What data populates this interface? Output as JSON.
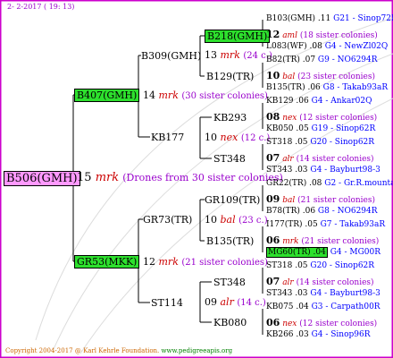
{
  "header": {
    "date": "2- 2-2017 ( 19: 13)"
  },
  "footer": {
    "copyright": "Copyright 2004-2017 @ Karl Kehrle Foundation.",
    "site": "www.pedigreeapis.org"
  },
  "root": {
    "id": "B506(GMH)",
    "num": "15",
    "mrk": "mrk",
    "note": "(Drones from 30 sister colonies)"
  },
  "g1": [
    {
      "id": "B407(GMH)",
      "num": "14",
      "mrk": "mrk",
      "note": "(30 sister colonies)"
    },
    {
      "id": "GR53(MKK)",
      "num": "12",
      "mrk": "mrk",
      "note": "(21 sister colonies)"
    }
  ],
  "g2": [
    {
      "id": "B309(GMH)"
    },
    {
      "id": "KB177"
    },
    {
      "id": "GR73(TR)"
    },
    {
      "id": "ST114"
    }
  ],
  "g2c": [
    {
      "num": "13",
      "mrk": "mrk",
      "note": "(24 c.)"
    },
    {
      "num": "10",
      "mrk": "nex",
      "note": "(12 c.)"
    },
    {
      "num": "10",
      "mrk": "bal",
      "note": "(23 c.)"
    },
    {
      "num": "09",
      "mrk": "alr",
      "note": "(14 c.)"
    }
  ],
  "g3": [
    "B218(GMH)",
    "B129(TR)",
    "KB293",
    "ST348",
    "GR109(TR)",
    "B135(TR)",
    "ST348",
    "KB080"
  ],
  "g4": [
    {
      "top": "B103(GMH) .11",
      "topb": "G21 - Sinop72R",
      "num": "12",
      "mrk": "aml",
      "note": "(18 sister colonies)",
      "bot": "L083(WF) .08",
      "botb": "G4 - NewZl02Q"
    },
    {
      "top": "B82(TR) .07",
      "topb": "G9 - NO6294R",
      "num": "10",
      "mrk": "bal",
      "note": "(23 sister colonies)",
      "bot": "B135(TR) .06",
      "botb": "G8 - Takab93aR"
    },
    {
      "top": "KB129 .06",
      "topb": "G4 - Ankar02Q",
      "num": "08",
      "mrk": "nex",
      "note": "(12 sister colonies)",
      "bot": "KB050 .05",
      "botb": "G19 - Sinop62R"
    },
    {
      "top": "ST318 .05",
      "topb": "G20 - Sinop62R",
      "num": "07",
      "mrk": "alr",
      "note": "(14 sister colonies)",
      "bot": "ST343 .03",
      "botb": "G4 - Bayburt98-3"
    },
    {
      "top": "GR22(TR) .08",
      "topb": "G2 - Gr.R.mounta",
      "num": "09",
      "mrk": "bal",
      "note": "(21 sister colonies)",
      "bot": "B78(TR) .06",
      "botb": "G8 - NO6294R"
    },
    {
      "top": "I177(TR) .05",
      "topb": "G7 - Takab93aR",
      "num": "06",
      "mrk": "mrk",
      "note": "(21 sister colonies)",
      "bot": "MG60(TR) .04",
      "botb": "G4 - MG00R"
    },
    {
      "top": "ST318 .05",
      "topb": "G20 - Sinop62R",
      "num": "07",
      "mrk": "alr",
      "note": "(14 sister colonies)",
      "bot": "ST343 .03",
      "botb": "G4 - Bayburt98-3"
    },
    {
      "top": "KB075 .04",
      "topb": "G3 - Carpath00R",
      "num": "06",
      "mrk": "nex",
      "note": "(12 sister colonies)",
      "bot": "KB266 .03",
      "botb": "G4 - Sinop96R"
    }
  ]
}
